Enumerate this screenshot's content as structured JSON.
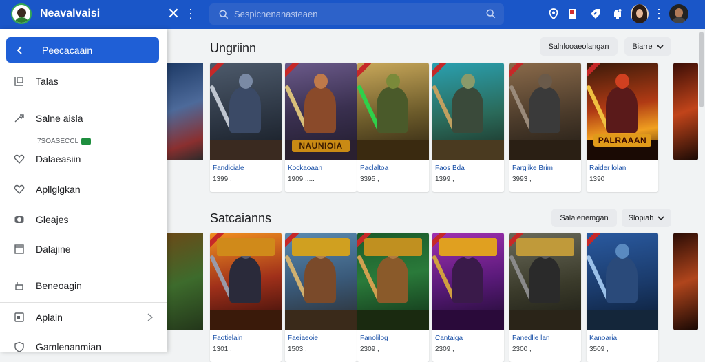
{
  "topbar": {
    "title": "Neavalvaisi",
    "search_placeholder": "Sespicnenanasteaen"
  },
  "drawer": {
    "active_label": "Peecacaain",
    "items": [
      {
        "label": "Talas",
        "icon": "window-icon"
      },
      {
        "label": "Salne aisla",
        "icon": "share-icon"
      },
      {
        "label": "Dalaeasiin",
        "icon": "heart-icon"
      },
      {
        "label": "Apllglgkan",
        "icon": "heart-outline-icon"
      },
      {
        "label": "Gleajes",
        "icon": "camera-icon"
      },
      {
        "label": "Dalajine",
        "icon": "square-icon"
      },
      {
        "label": "Beneoagin",
        "icon": "lock-icon"
      },
      {
        "label": "Aplain",
        "icon": "tablet-icon"
      },
      {
        "label": "Gamlenanmian",
        "icon": "shield-icon"
      }
    ],
    "sub_note": "7SOASECCL"
  },
  "sections": [
    {
      "title": "Ungriinn",
      "chip_primary": "Salnlooaeolangan",
      "chip_secondary": "Biarre",
      "cards": [
        {
          "name": "Fandiciale",
          "price": "1399 ,"
        },
        {
          "name": "Kockaoaan",
          "price": "1909 .....",
          "logo": "NAUNIOIA"
        },
        {
          "name": "Paclaltoa",
          "price": "3395 ,"
        },
        {
          "name": "Faos Bda",
          "price": "1399 ,"
        },
        {
          "name": "Farglike Brim",
          "price": "3993 ,"
        },
        {
          "name": "Raider lolan",
          "price": "1390",
          "logo": "PALRAAAN"
        }
      ]
    },
    {
      "title": "Satcaianns",
      "chip_primary": "Salaienemgan",
      "chip_secondary": "Slopiah",
      "cards": [
        {
          "name": "Faotielain",
          "price": "1301 ,"
        },
        {
          "name": "Faeiaeoie",
          "price": "1503 ,"
        },
        {
          "name": "Fanolilog",
          "price": "2309 ,"
        },
        {
          "name": "Cantaiga",
          "price": "2309 ,"
        },
        {
          "name": "Fanedlie lan",
          "price": "2300 ,"
        },
        {
          "name": "Kanoaria",
          "price": "3509 ,"
        }
      ]
    }
  ],
  "colors": {
    "topbar": "#1a56c8",
    "drawer_active": "#1f5fd6",
    "link": "#174ea6"
  }
}
